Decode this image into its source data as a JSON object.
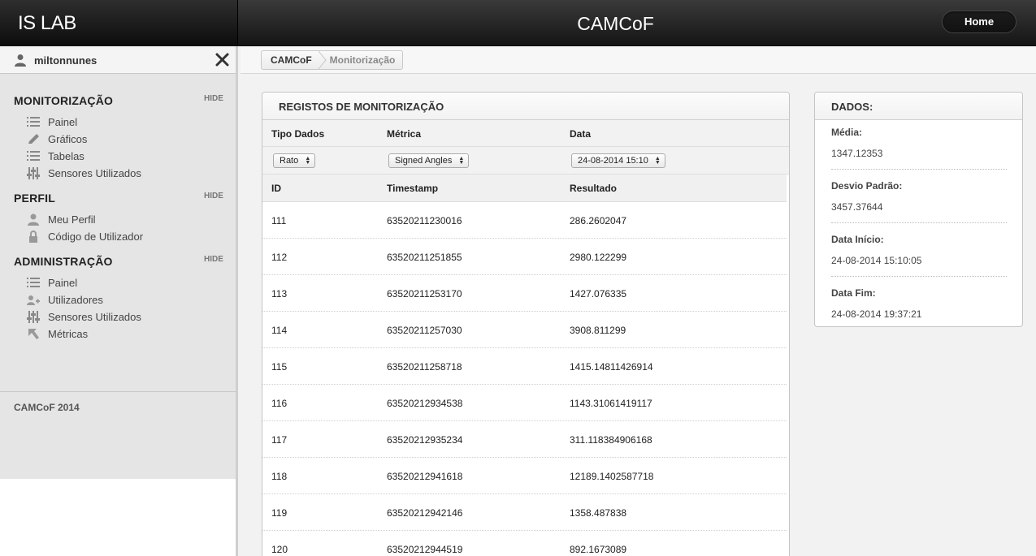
{
  "header": {
    "brand": "IS LAB",
    "title": "CAMCoF",
    "home_label": "Home"
  },
  "sidebar": {
    "username": "miltonnunes",
    "sections": [
      {
        "title": "MONITORIZAÇÃO",
        "hide_label": "HIDE",
        "items": [
          {
            "label": "Painel",
            "icon": "list-icon"
          },
          {
            "label": "Gráficos",
            "icon": "pencil-icon"
          },
          {
            "label": "Tabelas",
            "icon": "list-icon"
          },
          {
            "label": "Sensores Utilizados",
            "icon": "sliders-icon"
          }
        ]
      },
      {
        "title": "PERFIL",
        "hide_label": "HIDE",
        "items": [
          {
            "label": "Meu Perfil",
            "icon": "user-icon"
          },
          {
            "label": "Código de Utilizador",
            "icon": "lock-icon"
          }
        ]
      },
      {
        "title": "ADMINISTRAÇÃO",
        "hide_label": "HIDE",
        "items": [
          {
            "label": "Painel",
            "icon": "list-icon"
          },
          {
            "label": "Utilizadores",
            "icon": "users-icon"
          },
          {
            "label": "Sensores Utilizados",
            "icon": "sliders-icon"
          },
          {
            "label": "Métricas",
            "icon": "cursor-icon"
          }
        ]
      }
    ],
    "footer": "CAMCoF 2014"
  },
  "breadcrumb": {
    "items": [
      "CAMCoF",
      "Monitorização"
    ]
  },
  "registos": {
    "title": "REGISTOS DE MONITORIZAÇÃO",
    "filter_labels": [
      "Tipo Dados",
      "Métrica",
      "Data"
    ],
    "filters": {
      "tipo_dados": "Rato",
      "metrica": "Signed Angles",
      "data": "24-08-2014 15:10"
    },
    "columns": [
      "ID",
      "Timestamp",
      "Resultado"
    ],
    "rows": [
      [
        "111",
        "63520211230016",
        "286.2602047"
      ],
      [
        "112",
        "63520211251855",
        "2980.122299"
      ],
      [
        "113",
        "63520211253170",
        "1427.076335"
      ],
      [
        "114",
        "63520211257030",
        "3908.811299"
      ],
      [
        "115",
        "63520211258718",
        "1415.14811426914"
      ],
      [
        "116",
        "63520212934538",
        "1143.31061419117"
      ],
      [
        "117",
        "63520212935234",
        "311.118384906168"
      ],
      [
        "118",
        "63520212941618",
        "12189.1402587718"
      ],
      [
        "119",
        "63520212942146",
        "1358.487838"
      ],
      [
        "120",
        "63520212944519",
        "892.1673089"
      ]
    ]
  },
  "dados": {
    "title": "DADOS:",
    "stats": [
      {
        "label": "Média:",
        "value": "1347.12353"
      },
      {
        "label": "Desvio Padrão:",
        "value": "3457.37644"
      },
      {
        "label": "Data Início:",
        "value": "24-08-2014 15:10:05"
      },
      {
        "label": "Data Fim:",
        "value": "24-08-2014 19:37:21"
      }
    ]
  }
}
